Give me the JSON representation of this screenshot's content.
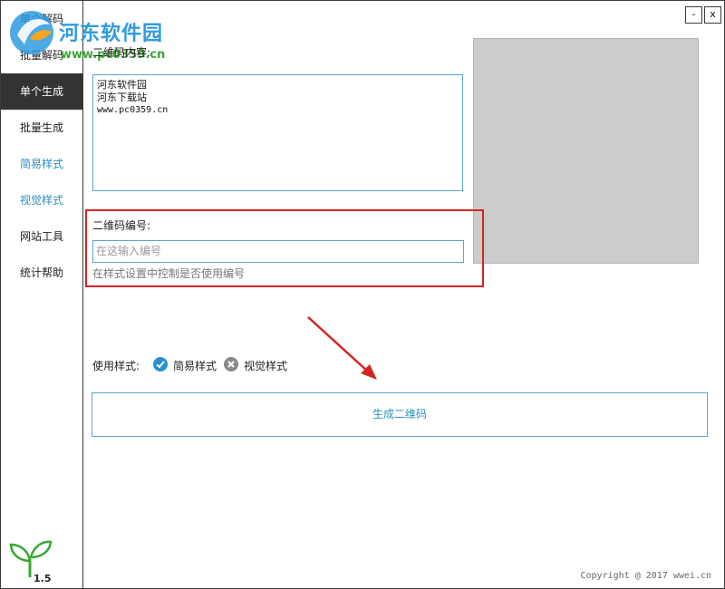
{
  "sidebar": {
    "items": [
      {
        "label": "单个解码"
      },
      {
        "label": "批量解码"
      },
      {
        "label": "单个生成"
      },
      {
        "label": "批量生成"
      },
      {
        "label": "简易样式"
      },
      {
        "label": "视觉样式"
      },
      {
        "label": "网站工具"
      },
      {
        "label": "统计帮助"
      }
    ],
    "version": "1.5"
  },
  "watermark": {
    "title": "河东软件园",
    "url": "www.pc0359.cn"
  },
  "window_controls": {
    "minimize": "-",
    "close": "x"
  },
  "content_section": {
    "label": "二维码内容:",
    "lines": [
      "河东软件园",
      "河东下载站",
      "www.pc0359.cn"
    ]
  },
  "number_section": {
    "label": "二维码编号:",
    "placeholder": "在这输入编号",
    "hint": "在样式设置中控制是否使用编号"
  },
  "style_section": {
    "label": "使用样式:",
    "options": [
      {
        "label": "简易样式",
        "state": "checked",
        "color": "#2a8fd0"
      },
      {
        "label": "视觉样式",
        "state": "unchecked",
        "color": "#8a8a8a"
      }
    ]
  },
  "generate_button": {
    "label": "生成二维码"
  },
  "footer": {
    "copyright": "Copyright @ 2017 wwei.cn"
  },
  "colors": {
    "accent": "#2a8fbd",
    "highlight_box": "#d22424",
    "active_nav": "#333333"
  }
}
